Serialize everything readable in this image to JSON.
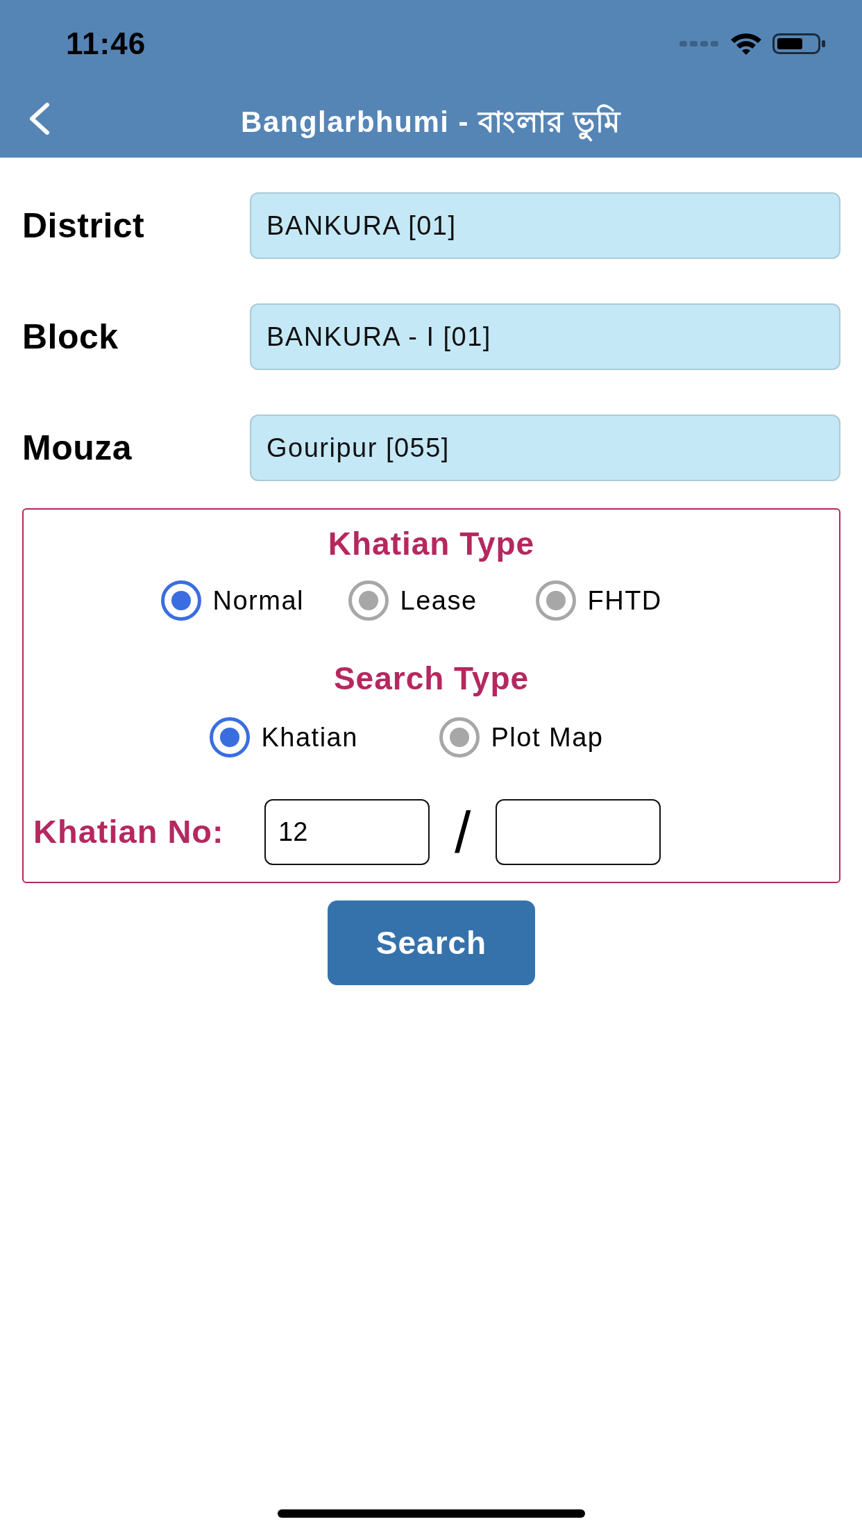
{
  "status_bar": {
    "time": "11:46"
  },
  "nav_bar": {
    "title": "Banglarbhumi - বাংলার ভুমি"
  },
  "fields": [
    {
      "label": "District",
      "value": "BANKURA [01]"
    },
    {
      "label": "Block",
      "value": "BANKURA - I [01]"
    },
    {
      "label": "Mouza",
      "value": "Gouripur [055]"
    }
  ],
  "khatian_type": {
    "title": "Khatian Type",
    "options": [
      {
        "label": "Normal",
        "selected": true
      },
      {
        "label": "Lease",
        "selected": false
      },
      {
        "label": "FHTD",
        "selected": false
      }
    ]
  },
  "search_type": {
    "title": "Search Type",
    "options": [
      {
        "label": "Khatian",
        "selected": true
      },
      {
        "label": "Plot Map",
        "selected": false
      }
    ]
  },
  "khatian_no": {
    "label": "Khatian No:",
    "value": "12",
    "separator": "/"
  },
  "search_button": {
    "label": "Search"
  }
}
